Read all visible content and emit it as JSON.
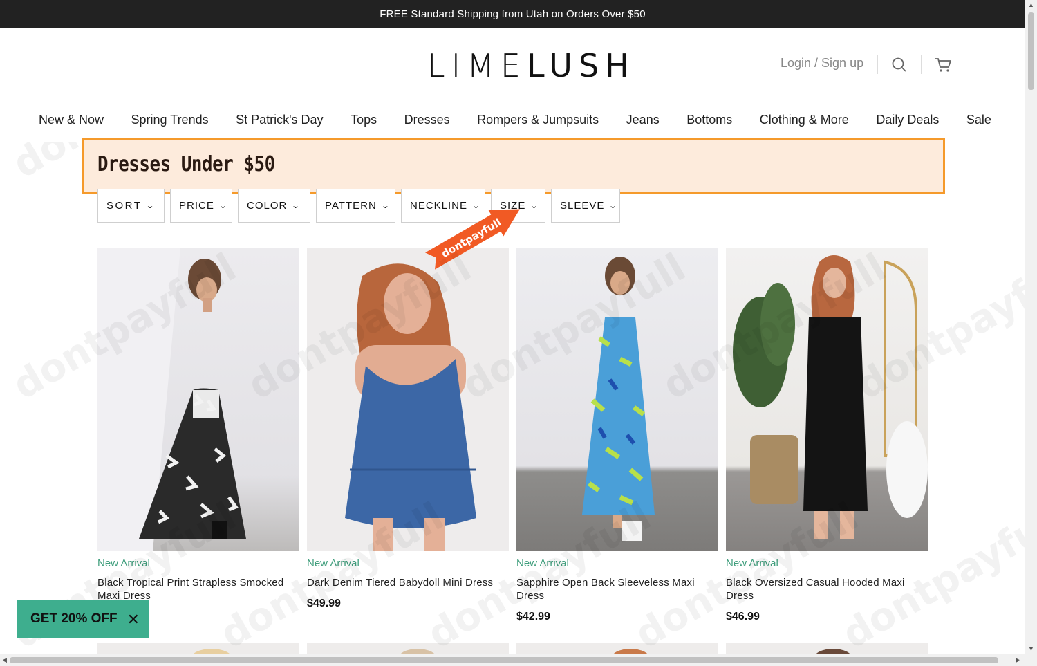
{
  "announcement": "FREE Standard Shipping from Utah on Orders Over $50",
  "header": {
    "logo_part1": "LIME",
    "logo_part2": "LUSH",
    "login_label": "Login / Sign up",
    "icons": [
      "search-icon",
      "cart-icon"
    ]
  },
  "nav": {
    "items": [
      "New & Now",
      "Spring Trends",
      "St Patrick's Day",
      "Tops",
      "Dresses",
      "Rompers & Jumpsuits",
      "Jeans",
      "Bottoms",
      "Clothing & More",
      "Daily Deals",
      "Sale"
    ]
  },
  "page_title": "Dresses Under $50",
  "filters": [
    "SORT",
    "PRICE",
    "COLOR",
    "PATTERN",
    "NECKLINE",
    "SIZE",
    "SLEEVE"
  ],
  "products": [
    {
      "badge": "New Arrival",
      "name": "Black Tropical Print Strapless Smocked Maxi Dress",
      "price": ""
    },
    {
      "badge": "New Arrival",
      "name": "Dark Denim Tiered Babydoll Mini Dress",
      "price": "$49.99"
    },
    {
      "badge": "New Arrival",
      "name": "Sapphire Open Back Sleeveless Maxi Dress",
      "price": "$42.99"
    },
    {
      "badge": "New Arrival",
      "name": "Black Oversized Casual Hooded Maxi Dress",
      "price": "$46.99"
    }
  ],
  "promo": {
    "label": "GET 20% OFF",
    "close": "✕"
  },
  "watermark": "dontpayfull",
  "colors": {
    "accent_green": "#3eae8e",
    "highlight_orange": "#f59a2b",
    "announcement_bg": "#222222"
  }
}
